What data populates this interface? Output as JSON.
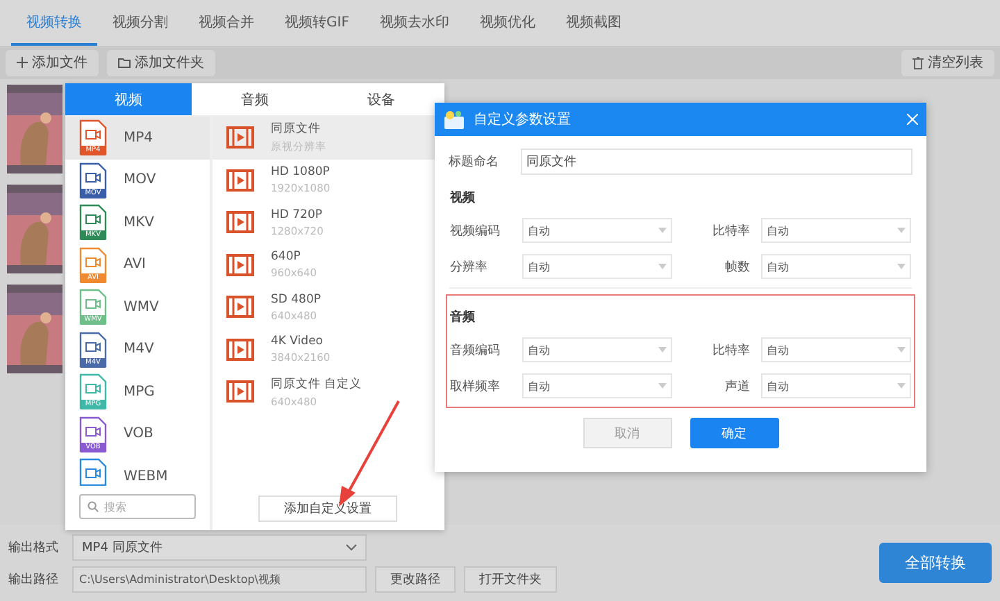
{
  "app_tabs": [
    {
      "label": "视频转换",
      "selected": true
    },
    {
      "label": "视频分割",
      "selected": false
    },
    {
      "label": "视频合并",
      "selected": false
    },
    {
      "label": "视频转GIF",
      "selected": false
    },
    {
      "label": "视频去水印",
      "selected": false
    },
    {
      "label": "视频优化",
      "selected": false
    },
    {
      "label": "视频截图",
      "selected": false
    }
  ],
  "toolbar": {
    "add_file": "添加文件",
    "add_folder": "添加文件夹",
    "clear_list": "清空列表"
  },
  "format_popup": {
    "tabs": [
      {
        "label": "视频",
        "selected": true
      },
      {
        "label": "音频",
        "selected": false
      },
      {
        "label": "设备",
        "selected": false
      }
    ],
    "formats": [
      {
        "name": "MP4",
        "badge": "MP4",
        "color": "#e0552a",
        "selected": true
      },
      {
        "name": "MOV",
        "badge": "MOV",
        "color": "#3a5fa8",
        "selected": false
      },
      {
        "name": "MKV",
        "badge": "MKV",
        "color": "#2e8b57",
        "selected": false
      },
      {
        "name": "AVI",
        "badge": "AVI",
        "color": "#f08a30",
        "selected": false
      },
      {
        "name": "WMV",
        "badge": "WMV",
        "color": "#6fbf8a",
        "selected": false
      },
      {
        "name": "M4V",
        "badge": "M4V",
        "color": "#4a6aa8",
        "selected": false
      },
      {
        "name": "MPG",
        "badge": "MPG",
        "color": "#3fb8a8",
        "selected": false
      },
      {
        "name": "VOB",
        "badge": "VOB",
        "color": "#8a5ad0",
        "selected": false
      },
      {
        "name": "WEBM",
        "color": "#2a8ae0",
        "selected": false
      }
    ],
    "presets": [
      {
        "title": "同原文件",
        "subtitle": "原视分辨率",
        "selected": true
      },
      {
        "title": "HD 1080P",
        "subtitle": "1920x1080",
        "selected": false
      },
      {
        "title": "HD 720P",
        "subtitle": "1280x720",
        "selected": false
      },
      {
        "title": "640P",
        "subtitle": "960x640",
        "selected": false
      },
      {
        "title": "SD 480P",
        "subtitle": "640x480",
        "selected": false
      },
      {
        "title": "4K Video",
        "subtitle": "3840x2160",
        "selected": false
      },
      {
        "title": "同原文件 自定义",
        "subtitle": "640x480",
        "selected": false
      }
    ],
    "search_placeholder": "搜索",
    "add_custom_button": "添加自定义设置"
  },
  "dialog": {
    "title": "自定义参数设置",
    "name_label": "标题命名",
    "name_value": "同原文件",
    "sections": [
      {
        "title": "视频",
        "highlighted": false,
        "fields": [
          {
            "label": "视频编码",
            "value": "自动"
          },
          {
            "label": "比特率",
            "value": "自动"
          },
          {
            "label": "分辨率",
            "value": "自动"
          },
          {
            "label": "帧数",
            "value": "自动"
          }
        ]
      },
      {
        "title": "音频",
        "highlighted": true,
        "fields": [
          {
            "label": "音频编码",
            "value": "自动"
          },
          {
            "label": "比特率",
            "value": "自动"
          },
          {
            "label": "取样频率",
            "value": "自动"
          },
          {
            "label": "声道",
            "value": "自动"
          }
        ]
      }
    ],
    "cancel": "取消",
    "ok": "确定"
  },
  "bottom": {
    "format_label": "输出格式",
    "format_value": "MP4  同原文件",
    "path_label": "输出路径",
    "path_value": "C:\\Users\\Administrator\\Desktop\\视频",
    "change_path": "更改路径",
    "open_folder": "打开文件夹",
    "convert_all": "全部转换"
  }
}
